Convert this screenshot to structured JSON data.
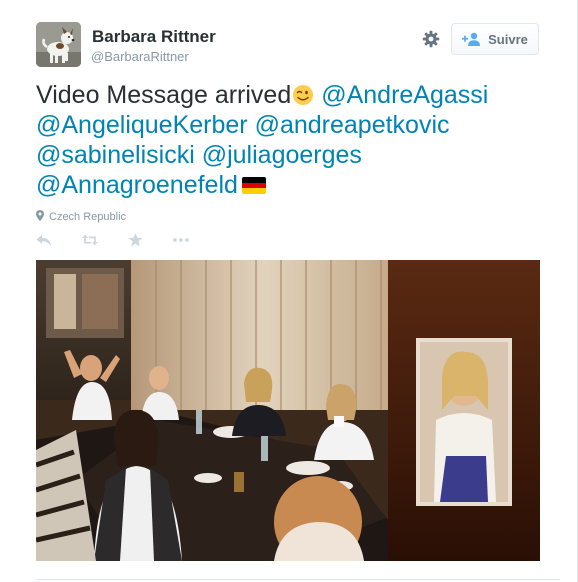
{
  "user": {
    "name": "Barbara Rittner",
    "handle": "@BarbaraRittner",
    "avatar_icon": "dog-avatar-icon"
  },
  "header": {
    "settings_icon": "gear-icon",
    "follow_label": "Suivre",
    "follow_icon": "add-user-icon"
  },
  "tweet": {
    "text_start": "Video Message arrived",
    "emoji": "winking-face-emoji",
    "mentions": [
      "@AndreAgassi",
      "@AngeliqueKerber",
      "@andreapetkovic",
      "@sabinelisicki",
      "@juliagoerges",
      "@Annagroenefeld"
    ],
    "flag": "germany-flag",
    "location": "Czech Republic"
  },
  "actions": [
    {
      "name": "reply",
      "icon": "reply-icon"
    },
    {
      "name": "retweet",
      "icon": "retweet-icon"
    },
    {
      "name": "favorite",
      "icon": "star-icon"
    },
    {
      "name": "more",
      "icon": "more-dots-icon"
    }
  ],
  "colors": {
    "link": "#0084b4",
    "text": "#292f33",
    "muted": "#8899a6",
    "icon": "#ccd6dd"
  }
}
